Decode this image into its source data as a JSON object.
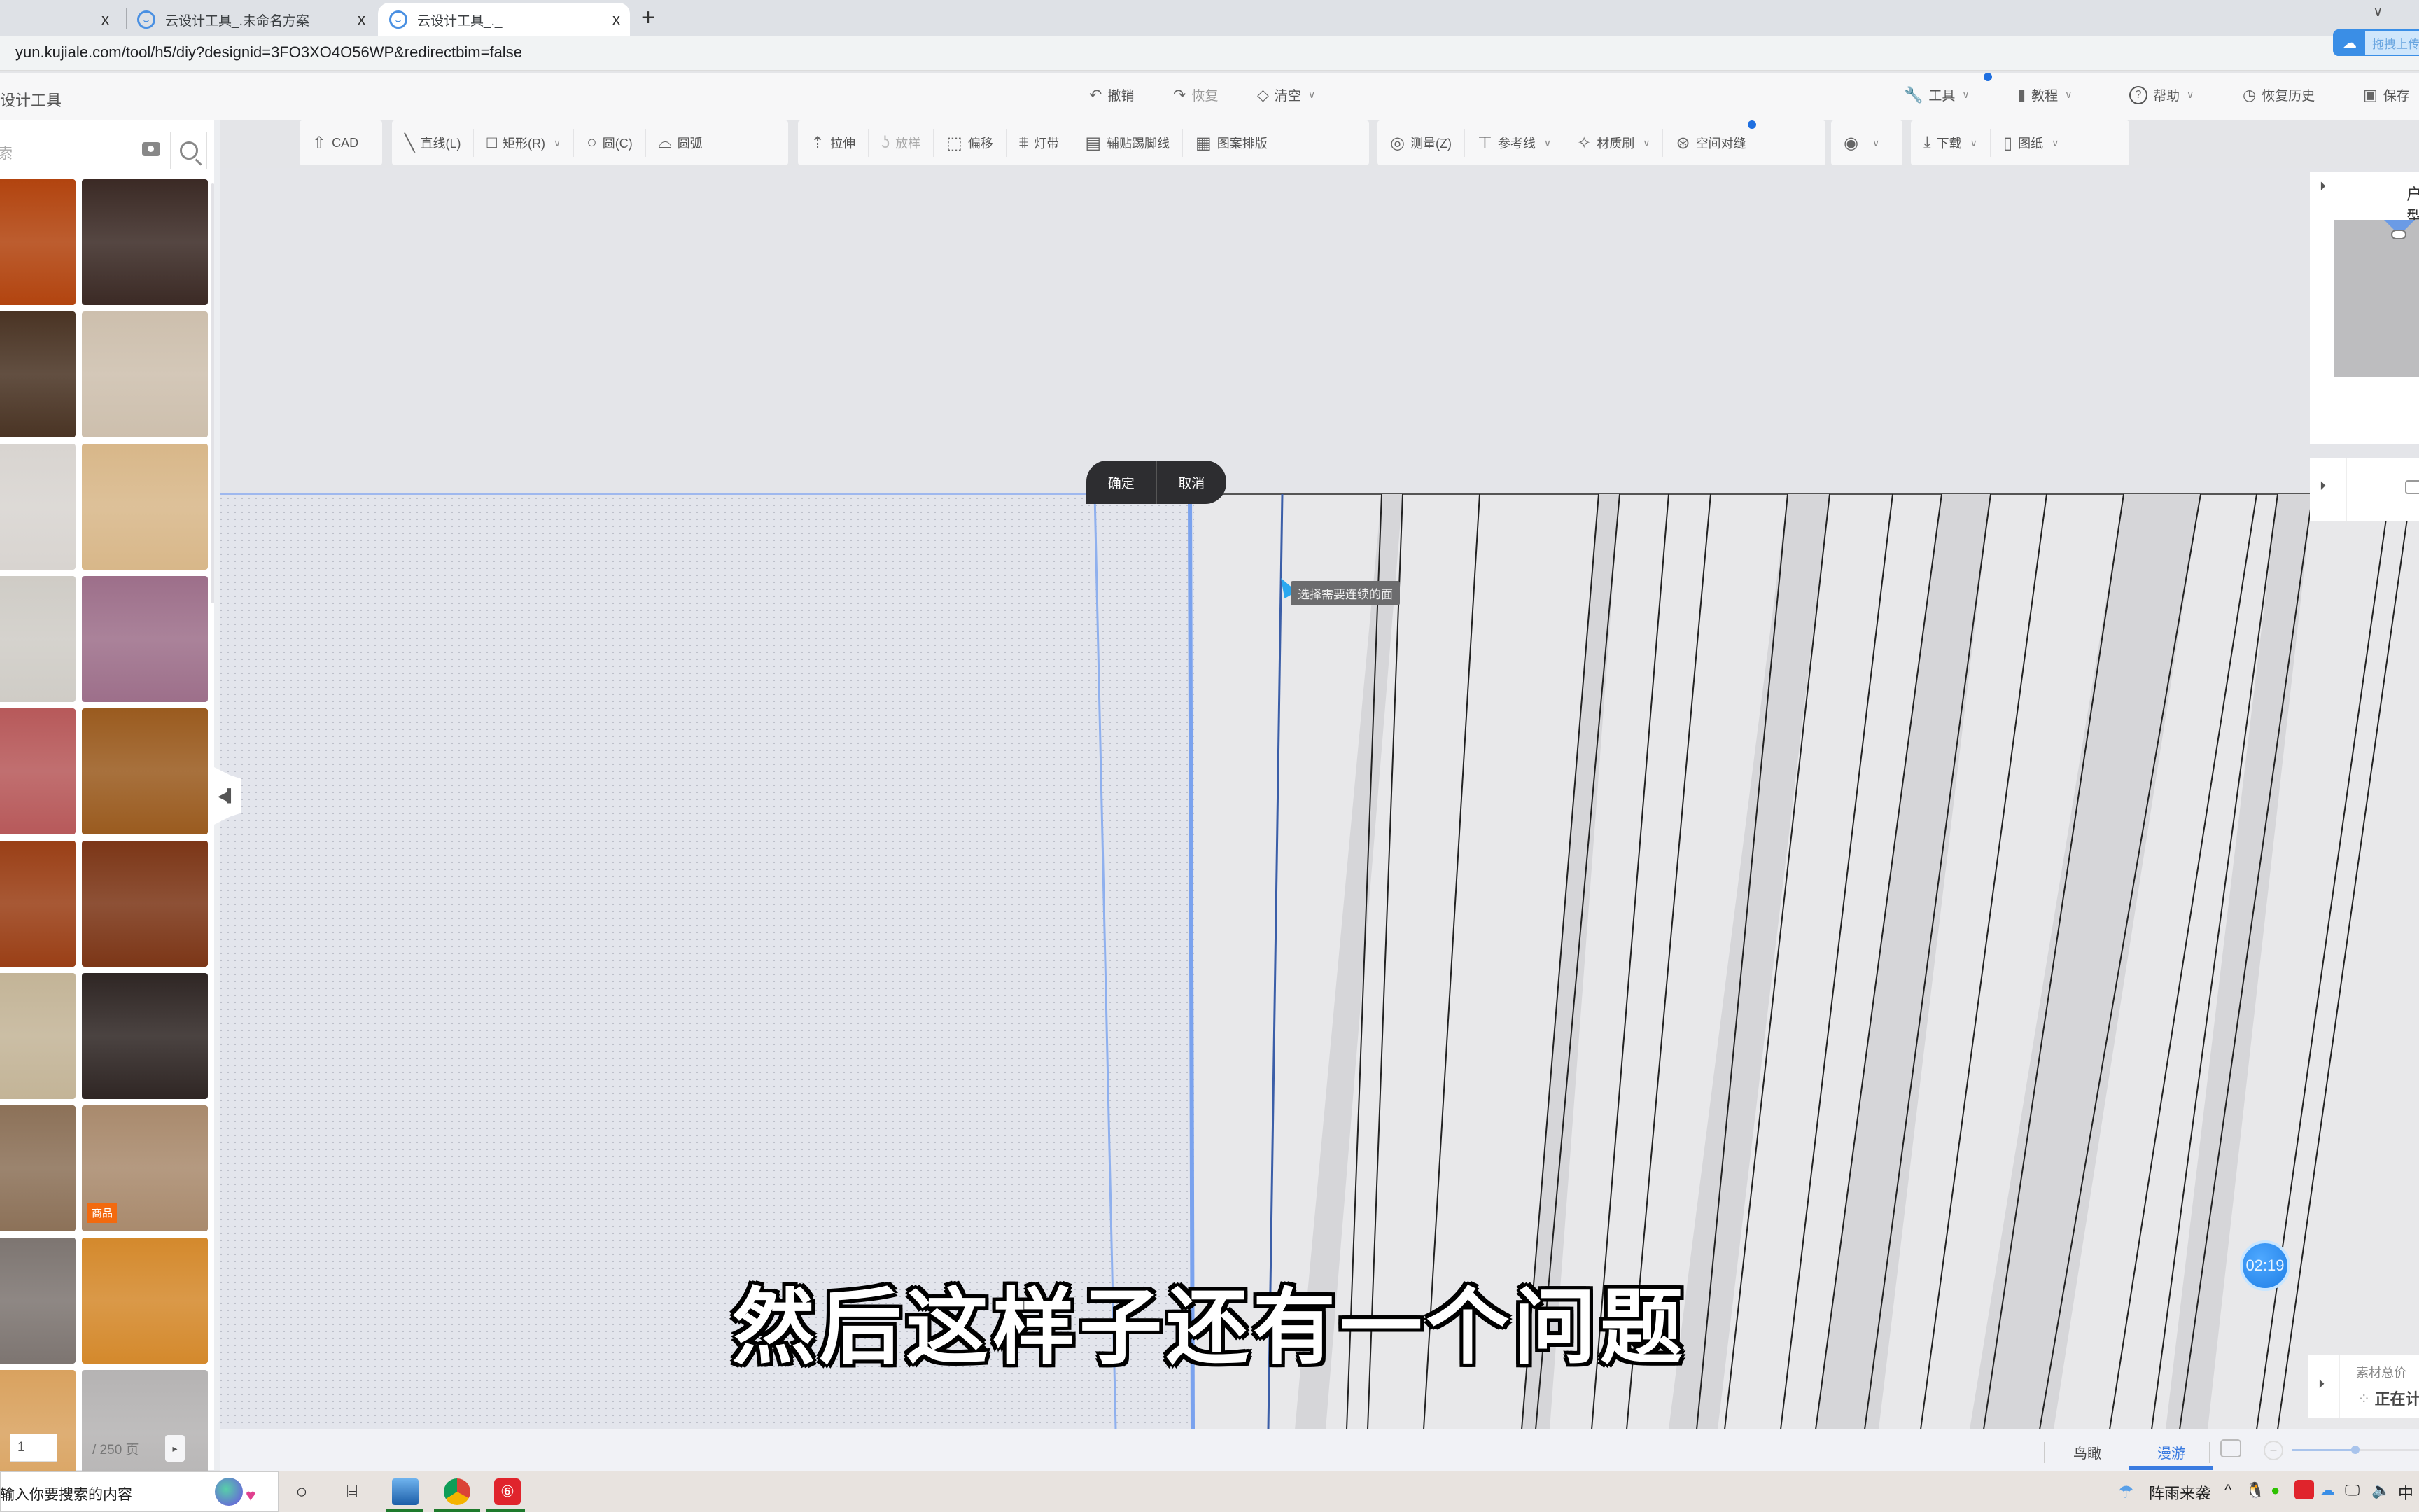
{
  "browser": {
    "tabs": [
      {
        "title": "",
        "close": "x"
      },
      {
        "title": "云设计工具_.未命名方案",
        "close": "x"
      },
      {
        "title": "云设计工具_._",
        "close": "x",
        "active": true
      }
    ],
    "new_tab": "+",
    "tab_dropdown": "∨",
    "url": "yun.kujiale.com/tool/h5/diy?designid=3FO3XO4O56WP&redirectbim=false",
    "cloud_upload_label": "拖拽上传"
  },
  "app": {
    "title": "云设计工具",
    "header_left": [
      {
        "label": "撤销",
        "icon": "undo-icon",
        "glyph": "↶"
      },
      {
        "label": "恢复",
        "icon": "redo-icon",
        "glyph": "↷",
        "disabled": true
      },
      {
        "label": "清空",
        "icon": "eraser-icon",
        "glyph": "◇",
        "caret": true
      }
    ],
    "header_right": [
      {
        "label": "工具",
        "icon": "wrench-icon",
        "glyph": "🔧",
        "caret": true,
        "dot": true
      },
      {
        "label": "教程",
        "icon": "book-icon",
        "glyph": "▮",
        "caret": true
      },
      {
        "label": "帮助",
        "icon": "help-icon",
        "glyph": "?",
        "caret": true
      },
      {
        "label": "恢复历史",
        "icon": "history-icon",
        "glyph": "◷"
      },
      {
        "label": "保存",
        "icon": "save-icon",
        "glyph": "▣"
      }
    ]
  },
  "toolbar": {
    "groups": [
      [
        {
          "label": "CAD",
          "icon": "upload-icon",
          "glyph": "⇧"
        }
      ],
      [
        {
          "label": "直线(L)",
          "icon": "line-icon",
          "glyph": "╲"
        },
        {
          "label": "矩形(R)",
          "icon": "rectangle-icon",
          "glyph": "□",
          "caret": true
        },
        {
          "label": "圆(C)",
          "icon": "circle-icon",
          "glyph": "○"
        },
        {
          "label": "圆弧",
          "icon": "arc-icon",
          "glyph": "⌓"
        }
      ],
      [
        {
          "label": "拉伸",
          "icon": "extrude-icon",
          "glyph": "⇡"
        },
        {
          "label": "放样",
          "icon": "loft-icon",
          "glyph": "ʖ",
          "disabled": true
        },
        {
          "label": "偏移",
          "icon": "offset-icon",
          "glyph": "⬚"
        },
        {
          "label": "灯带",
          "icon": "light-strip-icon",
          "glyph": "⩨"
        },
        {
          "label": "辅贴踢脚线",
          "icon": "skirting-icon",
          "glyph": "▤"
        },
        {
          "label": "图案排版",
          "icon": "pattern-icon",
          "glyph": "▦"
        }
      ],
      [
        {
          "label": "测量(Z)",
          "icon": "measure-icon",
          "glyph": "◎"
        },
        {
          "label": "参考线",
          "icon": "guide-line-icon",
          "glyph": "⊤",
          "caret": true
        },
        {
          "label": "材质刷",
          "icon": "material-brush-icon",
          "glyph": "✧",
          "caret": true
        },
        {
          "label": "空间对缝",
          "icon": "space-align-icon",
          "glyph": "⊛",
          "dot": true
        }
      ],
      [
        {
          "label": "",
          "icon": "eye-icon",
          "glyph": "◉",
          "caret": true
        }
      ],
      [
        {
          "label": "下载",
          "icon": "download-icon",
          "glyph": "⤓",
          "caret": true
        },
        {
          "label": "图纸",
          "icon": "blueprint-icon",
          "glyph": "▯",
          "caret": true
        }
      ]
    ]
  },
  "left_panel": {
    "search_placeholder": "在当前类目下搜索",
    "tiles": [
      {
        "color": "#b2440f"
      },
      {
        "color": "#3b2a25"
      },
      {
        "color": "#4a3424"
      },
      {
        "color": "#cdbfad"
      },
      {
        "color": "#d8d4d0"
      },
      {
        "color": "#d8b789"
      },
      {
        "color": "#cfccc6"
      },
      {
        "color": "#9d6f8a"
      },
      {
        "color": "#b7595a"
      },
      {
        "color": "#9a5b1f"
      },
      {
        "color": "#9a3f16"
      },
      {
        "color": "#7c3617"
      },
      {
        "color": "#c3b497"
      },
      {
        "color": "#2f2624"
      },
      {
        "color": "#8c7158"
      },
      {
        "color": "#a98a6d",
        "badge": "商品"
      },
      {
        "color": "#7d7571"
      },
      {
        "color": "#d4892c"
      },
      {
        "color": "#d9a25f"
      },
      {
        "color": "#b5b3b3"
      }
    ],
    "pager": {
      "current": "1",
      "total": "/ 250 页",
      "next": "▸"
    }
  },
  "canvas": {
    "confirm": "确定",
    "cancel": "取消",
    "tooltip": "选择需要连续的面",
    "subtitle": "然后这样子还有一个问题",
    "timer": "02:19"
  },
  "right_panel": {
    "title": "户型",
    "toggle": "⏵",
    "price_label": "素材总价",
    "price_value": "正在计算"
  },
  "view_bar": {
    "tabs": [
      {
        "label": "鸟瞰"
      },
      {
        "label": "漫游",
        "active": true
      }
    ],
    "zoom_level": 0.5
  },
  "taskbar": {
    "search_placeholder": "请输入你要搜索的内容",
    "weather": "阵雨来袭",
    "ime": "中"
  }
}
